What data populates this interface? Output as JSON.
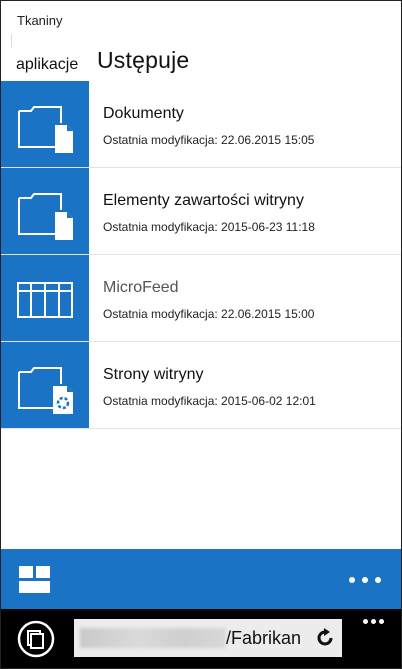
{
  "header": {
    "site_name": "Tkaniny",
    "app_label": "aplikacje",
    "page_title": "Ustępuje"
  },
  "items": [
    {
      "title": "Dokumenty",
      "meta": "Ostatnia modyfikacja: 22.06.2015 15:05",
      "icon": "document-library-icon"
    },
    {
      "title": "Elementy zawartości witryny",
      "meta": "Ostatnia modyfikacja: 2015-06-23 11:18",
      "icon": "document-library-icon"
    },
    {
      "title": "MicroFeed",
      "meta": "Ostatnia modyfikacja: 22.06.2015 15:00",
      "icon": "list-icon"
    },
    {
      "title": "Strony witryny",
      "meta": "Ostatnia modyfikacja: 2015-06-02 12:01",
      "icon": "site-pages-icon"
    }
  ],
  "bottom_bar": {
    "tiles_icon": "tiles-icon",
    "more_icon": "ellipsis-icon"
  },
  "browser": {
    "address_suffix": "/Fabrikan",
    "reload_icon": "reload-icon",
    "tabs_icon": "tabs-icon"
  },
  "colors": {
    "accent": "#1a73c4",
    "browser_bg": "#000000"
  }
}
